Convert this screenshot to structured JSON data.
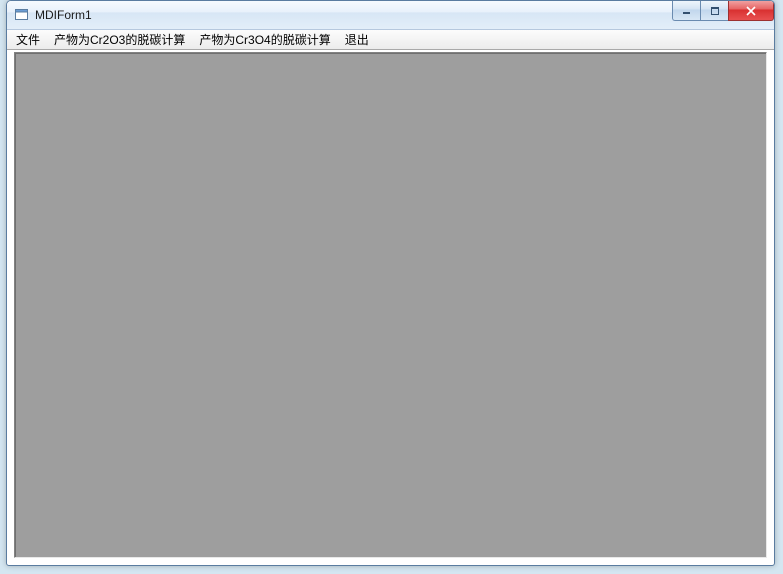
{
  "window": {
    "title": "MDIForm1"
  },
  "menubar": {
    "items": [
      {
        "label": "文件"
      },
      {
        "label": "产物为Cr2O3的脱碳计算"
      },
      {
        "label": "产物为Cr3O4的脱碳计算"
      },
      {
        "label": "退出"
      }
    ]
  }
}
